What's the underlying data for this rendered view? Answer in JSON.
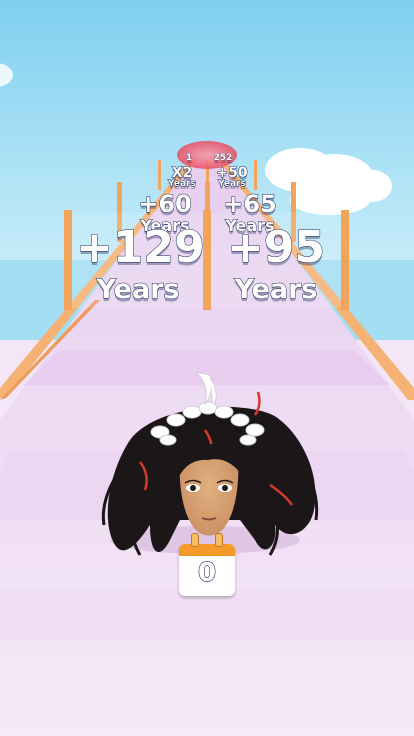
{
  "gates": {
    "near_left": {
      "value": "+129",
      "label": "Years"
    },
    "near_right": {
      "value": "+95",
      "label": "Years"
    },
    "mid_left": {
      "value": "+60",
      "label": "Years"
    },
    "mid_right": {
      "value": "+65",
      "label": "Years"
    },
    "far_left": {
      "value": "X2",
      "label": "Years"
    },
    "far_right": {
      "value": "+50",
      "label": "Years"
    },
    "farthest_left": {
      "value": "1"
    },
    "farthest_right": {
      "value": "252"
    }
  },
  "player": {
    "age_counter": "0"
  },
  "colors": {
    "sky": "#b9e6f7",
    "track": "#f3dff5",
    "track_stripe": "#ead0ef",
    "gate_posts": "#f3a45b",
    "calendar": "#f59a2a"
  }
}
